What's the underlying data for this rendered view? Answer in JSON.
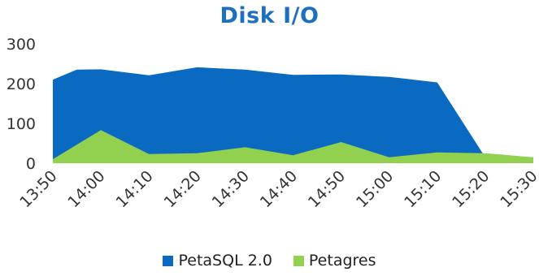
{
  "chart_data": {
    "type": "area",
    "title": "Disk I/O",
    "xlabel": "",
    "ylabel": "",
    "ylim": [
      0,
      300
    ],
    "yticks": [
      0,
      100,
      200,
      300
    ],
    "grid": false,
    "legend_position": "bottom",
    "categories": [
      "13:50",
      "14:00",
      "14:10",
      "14:20",
      "14:30",
      "14:40",
      "14:50",
      "15:00",
      "15:10",
      "15:20",
      "15:30"
    ],
    "series": [
      {
        "name": "PetaSQL 2.0",
        "color": "#0a6ac2",
        "x": [
          0,
          0.5,
          1,
          2,
          3,
          4,
          5,
          6,
          7,
          8,
          9,
          10
        ],
        "values": [
          210,
          235,
          236,
          221,
          241,
          235,
          222,
          223,
          217,
          203,
          15,
          15
        ]
      },
      {
        "name": "Petagres",
        "color": "#92d050",
        "x": [
          0,
          1,
          2,
          3,
          4,
          5,
          6,
          7,
          8,
          9,
          10
        ],
        "values": [
          10,
          83,
          23,
          25,
          40,
          20,
          53,
          15,
          27,
          25,
          15
        ]
      }
    ]
  }
}
